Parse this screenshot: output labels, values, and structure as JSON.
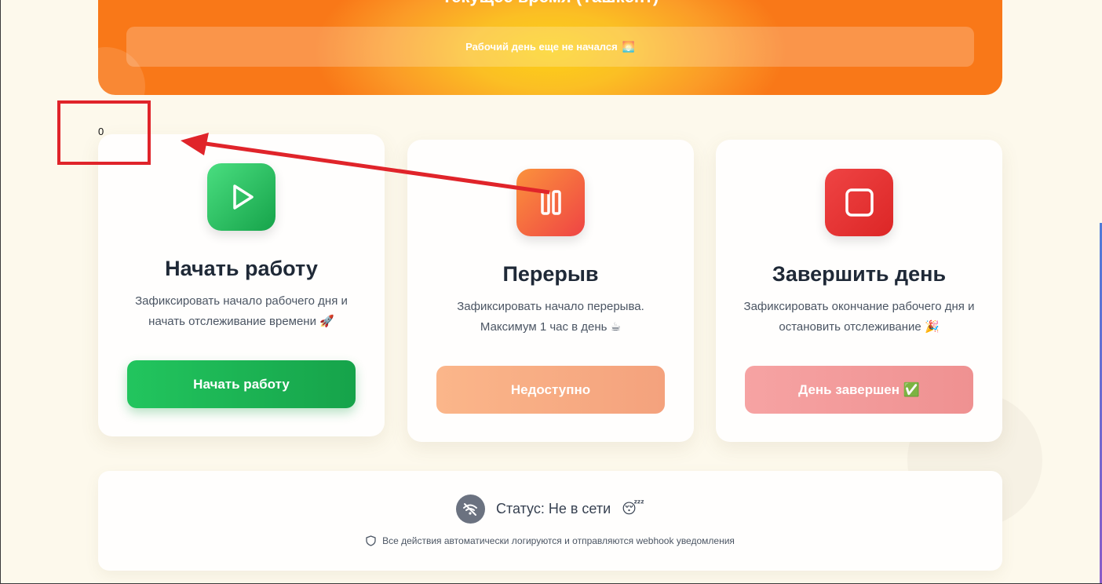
{
  "hero": {
    "title": "Текущее время (Ташкент)",
    "status_text": "Рабочий день еще не начался",
    "status_emoji": "🌅"
  },
  "annotation": {
    "value": "0"
  },
  "cards": [
    {
      "title": "Начать работу",
      "description": "Зафиксировать начало рабочего дня и начать отслеживание времени 🚀",
      "button": "Начать работу",
      "icon": "play-icon"
    },
    {
      "title": "Перерыв",
      "description": "Зафиксировать начало перерыва. Максимум 1 час в день ☕",
      "button": "Недоступно",
      "icon": "pause-icon"
    },
    {
      "title": "Завершить день",
      "description": "Зафиксировать окончание рабочего дня и остановить отслеживание 🎉",
      "button": "День завершен ✅",
      "icon": "stop-icon"
    }
  ],
  "footer": {
    "status": "Статус: Не в сети",
    "status_emoji": "😴",
    "note": "Все действия автоматически логируются и отправляются webhook уведомления",
    "icons": [
      "wifi-off-icon",
      "shield-icon"
    ]
  },
  "colors": {
    "hero_orange": "#f97818",
    "hero_yellow": "#fcd116",
    "start_green": "#16a34a",
    "break_orange": "#fb923c",
    "end_red": "#dc2626",
    "annotation_red": "#e0242a",
    "background": "#fdf9ec"
  }
}
